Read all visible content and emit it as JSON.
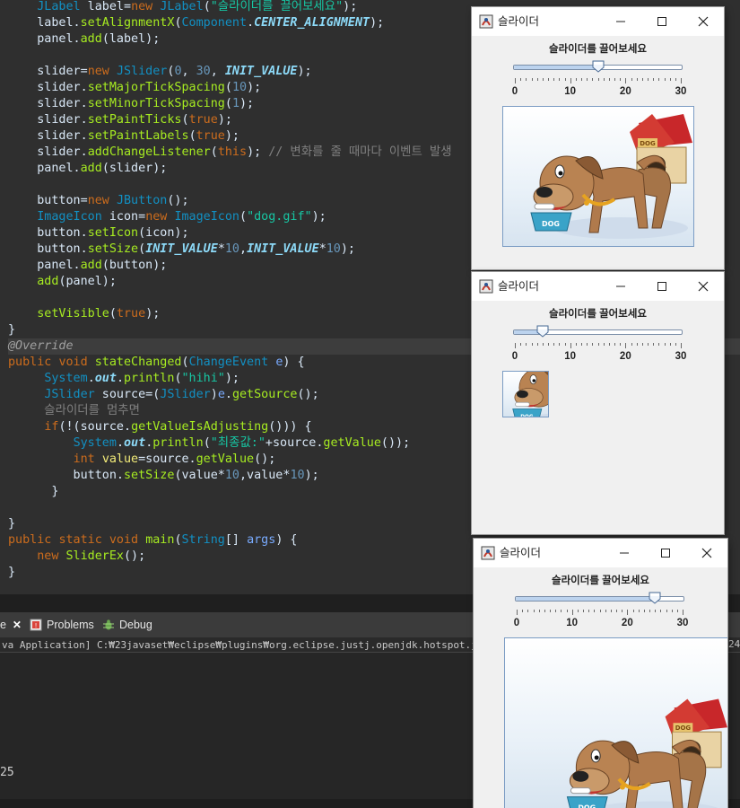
{
  "editor": {
    "lines": [
      [
        [
          "    ",
          "t-plain"
        ],
        [
          "JLabel",
          "t-type"
        ],
        [
          " label=",
          "t-plain"
        ],
        [
          "new",
          "t-kw"
        ],
        [
          " ",
          "t-plain"
        ],
        [
          "JLabel",
          "t-type"
        ],
        [
          "(",
          "t-plain"
        ],
        [
          "\"슬라이더를 끌어보세요\"",
          "t-str"
        ],
        [
          ");",
          "t-plain"
        ]
      ],
      [
        [
          "    label.",
          "t-plain"
        ],
        [
          "setAlignmentX",
          "t-method"
        ],
        [
          "(",
          "t-plain"
        ],
        [
          "Component",
          "t-type"
        ],
        [
          ".",
          "t-plain"
        ],
        [
          "CENTER_ALIGNMENT",
          "t-const"
        ],
        [
          ");",
          "t-plain"
        ]
      ],
      [
        [
          "    panel.",
          "t-plain"
        ],
        [
          "add",
          "t-method"
        ],
        [
          "(label);",
          "t-plain"
        ]
      ],
      [
        [
          "",
          "t-plain"
        ]
      ],
      [
        [
          "    slider=",
          "t-plain"
        ],
        [
          "new",
          "t-kw"
        ],
        [
          " ",
          "t-plain"
        ],
        [
          "JSlider",
          "t-type"
        ],
        [
          "(",
          "t-plain"
        ],
        [
          "0",
          "t-num"
        ],
        [
          ", ",
          "t-plain"
        ],
        [
          "30",
          "t-num"
        ],
        [
          ", ",
          "t-plain"
        ],
        [
          "INIT_VALUE",
          "t-const"
        ],
        [
          ");",
          "t-plain"
        ]
      ],
      [
        [
          "    slider.",
          "t-plain"
        ],
        [
          "setMajorTickSpacing",
          "t-method"
        ],
        [
          "(",
          "t-plain"
        ],
        [
          "10",
          "t-num"
        ],
        [
          ");",
          "t-plain"
        ]
      ],
      [
        [
          "    slider.",
          "t-plain"
        ],
        [
          "setMinorTickSpacing",
          "t-method"
        ],
        [
          "(",
          "t-plain"
        ],
        [
          "1",
          "t-num"
        ],
        [
          ");",
          "t-plain"
        ]
      ],
      [
        [
          "    slider.",
          "t-plain"
        ],
        [
          "setPaintTicks",
          "t-method"
        ],
        [
          "(",
          "t-plain"
        ],
        [
          "true",
          "t-kw"
        ],
        [
          ");",
          "t-plain"
        ]
      ],
      [
        [
          "    slider.",
          "t-plain"
        ],
        [
          "setPaintLabels",
          "t-method"
        ],
        [
          "(",
          "t-plain"
        ],
        [
          "true",
          "t-kw"
        ],
        [
          ");",
          "t-plain"
        ]
      ],
      [
        [
          "    slider.",
          "t-plain"
        ],
        [
          "addChangeListener",
          "t-method"
        ],
        [
          "(",
          "t-plain"
        ],
        [
          "this",
          "t-kw"
        ],
        [
          "); ",
          "t-plain"
        ],
        [
          "// 변화를 줄 때마다 이벤트 발생",
          "t-cmt"
        ]
      ],
      [
        [
          "    panel.",
          "t-plain"
        ],
        [
          "add",
          "t-method"
        ],
        [
          "(slider);",
          "t-plain"
        ]
      ],
      [
        [
          "",
          "t-plain"
        ]
      ],
      [
        [
          "    button=",
          "t-plain"
        ],
        [
          "new",
          "t-kw"
        ],
        [
          " ",
          "t-plain"
        ],
        [
          "JButton",
          "t-type"
        ],
        [
          "();",
          "t-plain"
        ]
      ],
      [
        [
          "    ",
          "t-plain"
        ],
        [
          "ImageIcon",
          "t-type"
        ],
        [
          " icon=",
          "t-plain"
        ],
        [
          "new",
          "t-kw"
        ],
        [
          " ",
          "t-plain"
        ],
        [
          "ImageIcon",
          "t-type"
        ],
        [
          "(",
          "t-plain"
        ],
        [
          "\"dog.gif\"",
          "t-str"
        ],
        [
          ");",
          "t-plain"
        ]
      ],
      [
        [
          "    button.",
          "t-plain"
        ],
        [
          "setIcon",
          "t-method"
        ],
        [
          "(icon);",
          "t-plain"
        ]
      ],
      [
        [
          "    button.",
          "t-plain"
        ],
        [
          "setSize",
          "t-method"
        ],
        [
          "(",
          "t-plain"
        ],
        [
          "INIT_VALUE",
          "t-const"
        ],
        [
          "*",
          "t-plain"
        ],
        [
          "10",
          "t-num"
        ],
        [
          ",",
          "t-plain"
        ],
        [
          "INIT_VALUE",
          "t-const"
        ],
        [
          "*",
          "t-plain"
        ],
        [
          "10",
          "t-num"
        ],
        [
          ");",
          "t-plain"
        ]
      ],
      [
        [
          "    panel.",
          "t-plain"
        ],
        [
          "add",
          "t-method"
        ],
        [
          "(button);",
          "t-plain"
        ]
      ],
      [
        [
          "    ",
          "t-plain"
        ],
        [
          "add",
          "t-method"
        ],
        [
          "(panel);",
          "t-plain"
        ]
      ],
      [
        [
          "",
          "t-plain"
        ]
      ],
      [
        [
          "    ",
          "t-plain"
        ],
        [
          "setVisible",
          "t-method"
        ],
        [
          "(",
          "t-plain"
        ],
        [
          "true",
          "t-kw"
        ],
        [
          ");",
          "t-plain"
        ]
      ],
      [
        [
          "}",
          "t-plain"
        ]
      ],
      [
        [
          "@Override",
          "t-ann"
        ]
      ],
      [
        [
          "public",
          "t-kw"
        ],
        [
          " ",
          "t-plain"
        ],
        [
          "void",
          "t-kw"
        ],
        [
          " ",
          "t-plain"
        ],
        [
          "stateChanged",
          "t-method"
        ],
        [
          "(",
          "t-plain"
        ],
        [
          "ChangeEvent",
          "t-type"
        ],
        [
          " ",
          "t-plain"
        ],
        [
          "e",
          "t-param"
        ],
        [
          ") {",
          "t-plain"
        ]
      ],
      [
        [
          "     ",
          "t-plain"
        ],
        [
          "System",
          "t-type"
        ],
        [
          ".",
          "t-plain"
        ],
        [
          "out",
          "t-field"
        ],
        [
          ".",
          "t-plain"
        ],
        [
          "println",
          "t-method"
        ],
        [
          "(",
          "t-plain"
        ],
        [
          "\"hihi\"",
          "t-str"
        ],
        [
          ");",
          "t-plain"
        ]
      ],
      [
        [
          "     ",
          "t-plain"
        ],
        [
          "JSlider",
          "t-type"
        ],
        [
          " source=(",
          "t-plain"
        ],
        [
          "JSlider",
          "t-type"
        ],
        [
          ")",
          "t-plain"
        ],
        [
          "e",
          "t-param"
        ],
        [
          ".",
          "t-plain"
        ],
        [
          "getSource",
          "t-method"
        ],
        [
          "();",
          "t-plain"
        ]
      ],
      [
        [
          "     슬라이더를 멈추면",
          "t-cmt"
        ]
      ],
      [
        [
          "     ",
          "t-plain"
        ],
        [
          "if",
          "t-kw"
        ],
        [
          "(!(source.",
          "t-plain"
        ],
        [
          "getValueIsAdjusting",
          "t-method"
        ],
        [
          "())) {",
          "t-plain"
        ]
      ],
      [
        [
          "         ",
          "t-plain"
        ],
        [
          "System",
          "t-type"
        ],
        [
          ".",
          "t-plain"
        ],
        [
          "out",
          "t-field"
        ],
        [
          ".",
          "t-plain"
        ],
        [
          "println",
          "t-method"
        ],
        [
          "(",
          "t-plain"
        ],
        [
          "\"최종값:\"",
          "t-str"
        ],
        [
          "+source.",
          "t-plain"
        ],
        [
          "getValue",
          "t-method"
        ],
        [
          "());",
          "t-plain"
        ]
      ],
      [
        [
          "         ",
          "t-plain"
        ],
        [
          "int",
          "t-kw"
        ],
        [
          " ",
          "t-plain"
        ],
        [
          "value",
          "t-var"
        ],
        [
          "=source.",
          "t-plain"
        ],
        [
          "getValue",
          "t-method"
        ],
        [
          "();",
          "t-plain"
        ]
      ],
      [
        [
          "         button.",
          "t-plain"
        ],
        [
          "setSize",
          "t-method"
        ],
        [
          "(value*",
          "t-plain"
        ],
        [
          "10",
          "t-num"
        ],
        [
          ",value*",
          "t-plain"
        ],
        [
          "10",
          "t-num"
        ],
        [
          ");",
          "t-plain"
        ]
      ],
      [
        [
          "      }",
          "t-plain"
        ]
      ],
      [
        [
          "",
          "t-plain"
        ]
      ],
      [
        [
          "}",
          "t-plain"
        ]
      ],
      [
        [
          "public",
          "t-kw"
        ],
        [
          " ",
          "t-plain"
        ],
        [
          "static",
          "t-kw"
        ],
        [
          " ",
          "t-plain"
        ],
        [
          "void",
          "t-kw"
        ],
        [
          " ",
          "t-plain"
        ],
        [
          "main",
          "t-method"
        ],
        [
          "(",
          "t-plain"
        ],
        [
          "String",
          "t-type"
        ],
        [
          "[] ",
          "t-plain"
        ],
        [
          "args",
          "t-param"
        ],
        [
          ") {",
          "t-plain"
        ]
      ],
      [
        [
          "    ",
          "t-plain"
        ],
        [
          "new",
          "t-kw"
        ],
        [
          " ",
          "t-plain"
        ],
        [
          "SliderEx",
          "t-method"
        ],
        [
          "();",
          "t-plain"
        ]
      ],
      [
        [
          "}",
          "t-plain"
        ]
      ]
    ]
  },
  "console": {
    "tabs": [
      {
        "label": "e",
        "icon": "close-icon"
      },
      {
        "label": "Problems",
        "icon": "problems-icon"
      },
      {
        "label": "Debug",
        "icon": "debug-icon"
      }
    ],
    "launch_text": "va Application] C:₩23javaset₩eclipse₩plugins₩org.eclipse.justj.openjdk.hotspot.jre.full.win32.x86_",
    "launch_text_right": "24",
    "output": "25"
  },
  "windows": [
    {
      "title": "슬라이더",
      "label": "슬라이더를 끌어보세요",
      "slider": {
        "min": 0,
        "max": 30,
        "value": 15,
        "major": 10,
        "minor": 1
      },
      "button_size": 150
    },
    {
      "title": "슬라이더",
      "label": "슬라이더를 끌어보세요",
      "slider": {
        "min": 0,
        "max": 30,
        "value": 5,
        "major": 10,
        "minor": 1
      },
      "button_size": 50
    },
    {
      "title": "슬라이더",
      "label": "슬라이더를 끌어보세요",
      "slider": {
        "min": 0,
        "max": 30,
        "value": 25,
        "major": 10,
        "minor": 1
      },
      "button_size": 250
    }
  ],
  "tick_labels": [
    "0",
    "10",
    "20",
    "30"
  ]
}
